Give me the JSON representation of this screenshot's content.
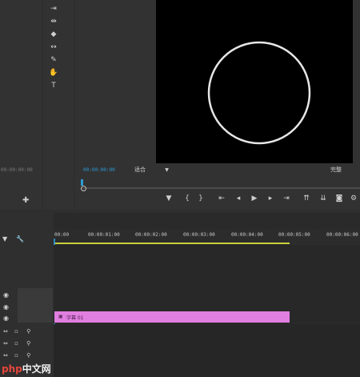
{
  "source_monitor": {
    "timecode": "00:00:00:00"
  },
  "tools": {
    "icons": [
      "track-select-icon",
      "ripple-edit-icon",
      "razor-icon",
      "slip-icon",
      "pen-icon",
      "hand-icon",
      "type-icon"
    ],
    "type_glyph": "T"
  },
  "program_monitor": {
    "timecode": "00:00:00:00",
    "fit_label": "适合",
    "quality_label": "完整"
  },
  "timeline": {
    "ruler_ticks": [
      "00:00",
      "00:00:01:00",
      "00:00:02:00",
      "00:00:03:00",
      "00:00:04:00",
      "00:00:05:00",
      "00:00:06:00"
    ],
    "clip_label": "字幕 01"
  },
  "colors": {
    "playhead": "#2e9bd6",
    "work_area": "#c8d23a",
    "clip": "#e07fe0",
    "monitor_bg": "#000000",
    "circle": "#e6e6e6"
  },
  "watermark": "php中文网"
}
